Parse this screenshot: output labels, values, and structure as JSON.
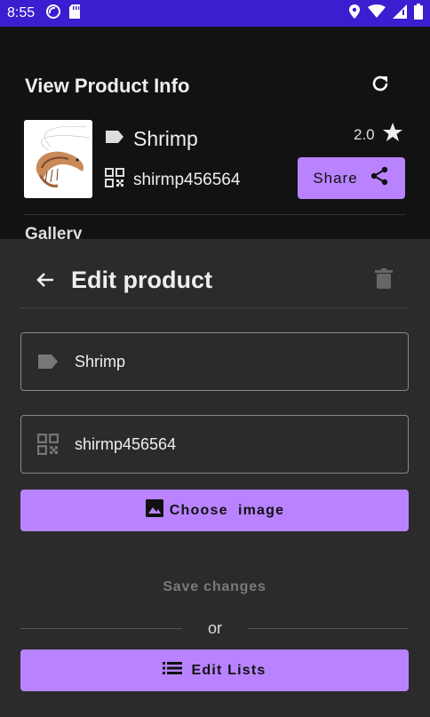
{
  "status_bar": {
    "time": "8:55",
    "left_icons": [
      "do-not-disturb-icon",
      "sd-card-icon"
    ],
    "right_icons": [
      "location-icon",
      "wifi-icon",
      "cell-signal-icon",
      "battery-icon"
    ],
    "color": "#3a1ed0"
  },
  "header": {
    "title": "View Product Info",
    "refresh_icon": "refresh-icon"
  },
  "product": {
    "name": "Shrimp",
    "code": "shirmp456564",
    "rating": "2.0",
    "share_label": "Share",
    "image_icon": "shrimp-photo"
  },
  "gallery": {
    "label": "Gallery"
  },
  "edit_sheet": {
    "title": "Edit product",
    "name_value": "Shrimp",
    "code_value": "shirmp456564",
    "choose_image_label": "Choose  image",
    "save_label": "Save changes",
    "or_label": "or",
    "edit_lists_label": "Edit Lists"
  },
  "colors": {
    "accent": "#b983ff",
    "sheet_bg": "#2b2b2b",
    "page_bg": "#121212"
  }
}
